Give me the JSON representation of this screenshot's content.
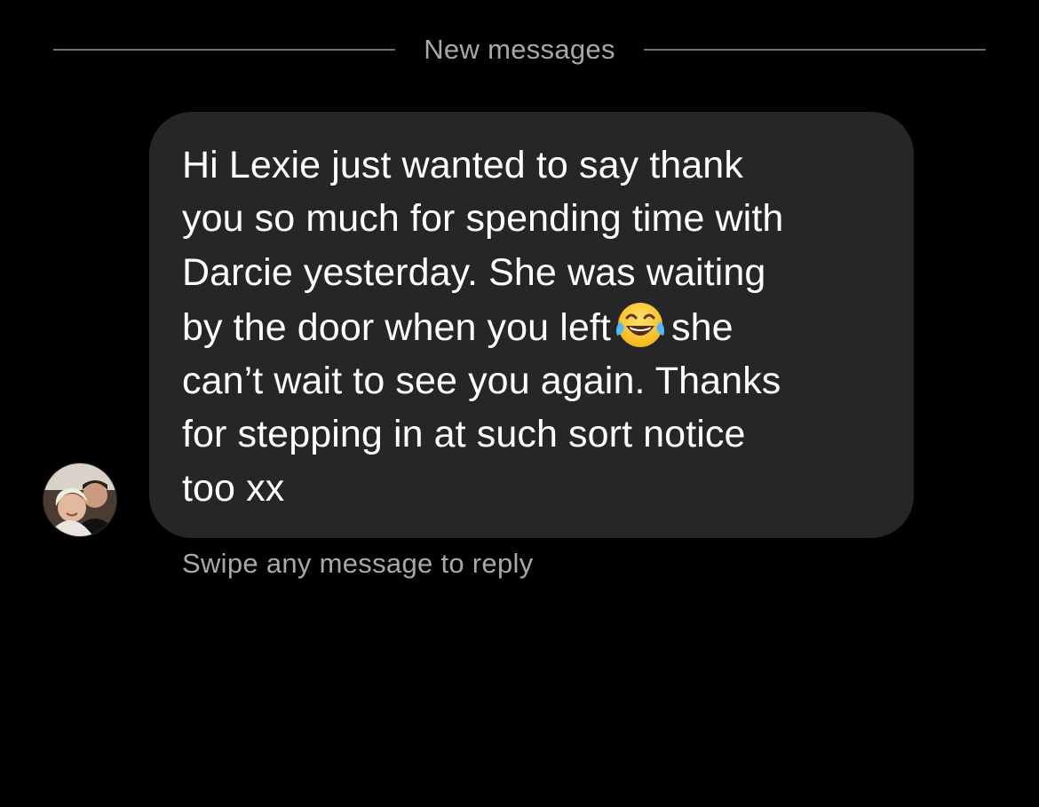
{
  "divider": {
    "label": "New messages"
  },
  "message": {
    "lines": [
      "Hi Lexie just wanted to say thank",
      "you so much for spending time with",
      "Darcie yesterday. She was waiting",
      "by the door when you left",
      "she",
      "can’t wait to see you again. Thanks",
      "for stepping in at such sort notice",
      "too xx"
    ],
    "emoji": "face-with-tears-of-joy-icon"
  },
  "hint": {
    "text": "Swipe any message to reply"
  },
  "colors": {
    "background": "#000000",
    "bubble": "#262626",
    "text": "#ffffff",
    "secondary_text": "#a8a8a8",
    "divider": "#6f6f6f"
  }
}
